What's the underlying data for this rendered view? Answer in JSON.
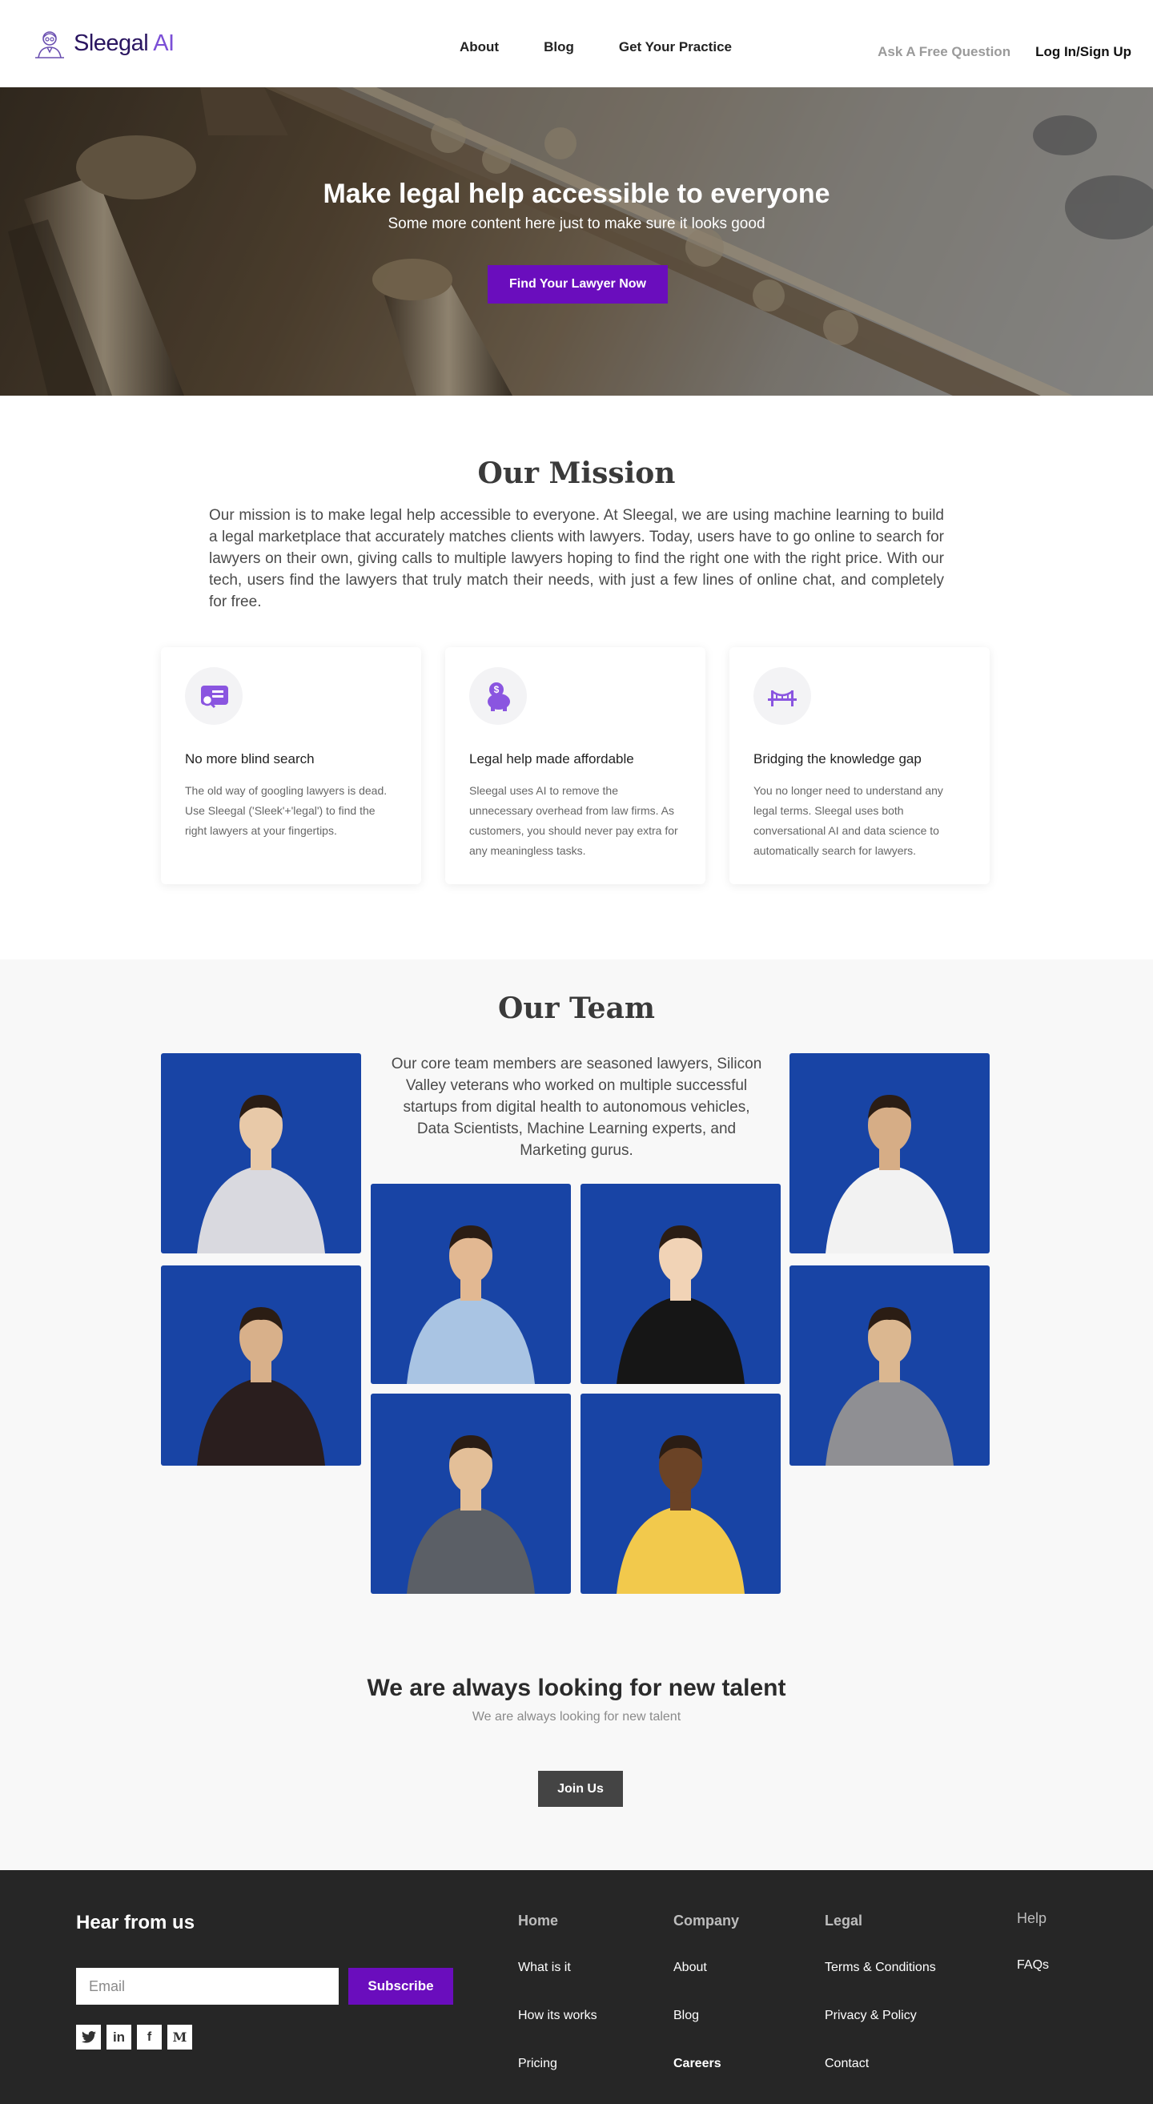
{
  "header": {
    "logo": {
      "brand": "Sleegal",
      "suffix": " AI"
    },
    "nav": [
      "About",
      "Blog",
      "Get Your Practice"
    ],
    "ask_label": "Ask A Free Question",
    "login_label": "Log In/Sign Up"
  },
  "hero": {
    "title": "Make legal help accessible to everyone",
    "subtitle": "Some more content here just to make sure it looks good",
    "cta_label": "Find Your Lawyer Now"
  },
  "mission": {
    "title": "Our Mission",
    "text": "Our mission is to make legal help accessible to everyone. At Sleegal, we are using machine learning to build a legal marketplace that accurately matches clients with lawyers. Today, users have to go online to search for lawyers on their own, giving calls to multiple lawyers hoping to find the right one with the right price. With our tech, users find the lawyers that truly match their needs, with just a few lines of online chat, and completely for free.",
    "cards": [
      {
        "icon": "search-list-icon",
        "title": "No more blind search",
        "text": "The old way of googling lawyers is dead. Use Sleegal ('Sleek'+'legal') to find the right lawyers at your fingertips."
      },
      {
        "icon": "piggy-bank-icon",
        "title": "Legal help made affordable",
        "text": "Sleegal uses AI to remove the unnecessary overhead from law firms. As customers, you should never pay extra for any meaningless tasks."
      },
      {
        "icon": "bridge-icon",
        "title": "Bridging the knowledge gap",
        "text": "You no longer need to understand any legal terms. Sleegal uses both conversational AI and data science to automatically search for lawyers."
      }
    ]
  },
  "team": {
    "title": "Our Team",
    "intro": "Our core team members are seasoned lawyers, Silicon Valley veterans who worked on multiple successful startups from digital health to autonomous vehicles, Data Scientists, Machine Learning experts, and Marketing gurus."
  },
  "talent": {
    "title": "We are always looking for new talent",
    "subtitle": "We are always looking for new talent",
    "cta_label": "Join Us"
  },
  "footer": {
    "newsletter_title": "Hear from us",
    "email_placeholder": "Email",
    "subscribe_label": "Subscribe",
    "socials": [
      "twitter-icon",
      "linkedin-icon",
      "facebook-icon",
      "medium-icon"
    ],
    "columns": [
      {
        "heading": "Home",
        "links": [
          "What is it",
          "How its works",
          "Pricing"
        ]
      },
      {
        "heading": "Company",
        "links": [
          "About",
          "Blog",
          "Careers"
        ]
      },
      {
        "heading": "Legal",
        "links": [
          "Terms & Conditions",
          "Privacy & Policy",
          "Contact"
        ]
      },
      {
        "heading": "Help",
        "links": [
          "FAQs"
        ]
      }
    ]
  },
  "colors": {
    "accent": "#6a0dbd",
    "team_bg": "#1844a5",
    "footer_bg": "#262626",
    "icon_purple": "#8a55e0"
  }
}
